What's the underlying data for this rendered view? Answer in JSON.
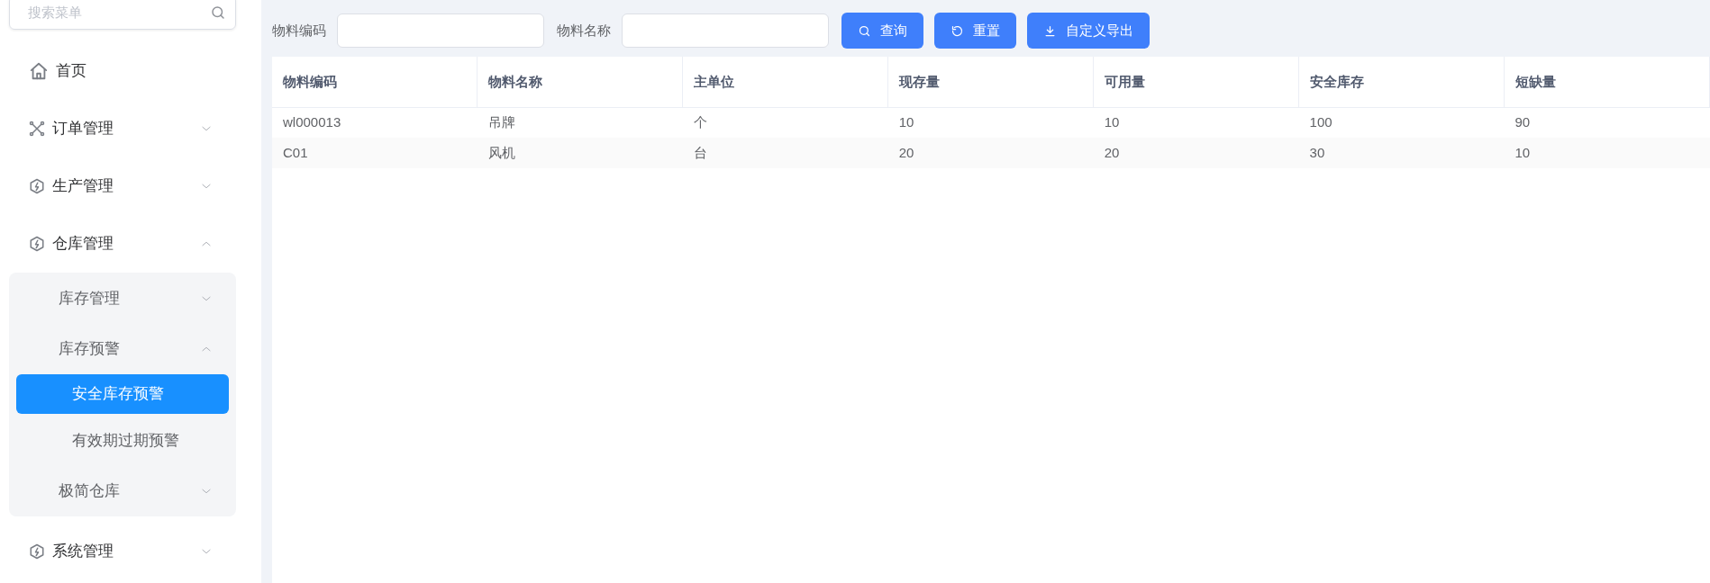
{
  "sidebar": {
    "search": {
      "placeholder": "搜索菜单"
    },
    "items": [
      {
        "label": "首页"
      },
      {
        "label": "订单管理",
        "expanded": false
      },
      {
        "label": "生产管理",
        "expanded": false
      },
      {
        "label": "仓库管理",
        "expanded": true,
        "children": [
          {
            "label": "库存管理",
            "expanded": false
          },
          {
            "label": "库存预警",
            "expanded": true,
            "children": [
              {
                "label": "安全库存预警",
                "selected": true
              },
              {
                "label": "有效期过期预警",
                "selected": false
              }
            ]
          },
          {
            "label": "极简仓库",
            "expanded": false
          }
        ]
      },
      {
        "label": "系统管理",
        "expanded": false
      }
    ]
  },
  "filters": [
    {
      "label": "物料编码"
    },
    {
      "label": "物料名称"
    }
  ],
  "buttons": [
    {
      "label": "查询",
      "kind": "search"
    },
    {
      "label": "重置",
      "kind": "reset"
    },
    {
      "label": "自定义导出",
      "kind": "export"
    }
  ],
  "table": {
    "columns": [
      "物料编码",
      "物料名称",
      "主单位",
      "现存量",
      "可用量",
      "安全库存",
      "短缺量"
    ],
    "rows": [
      [
        "wl000013",
        "吊牌",
        "个",
        "10",
        "10",
        "100",
        "90"
      ],
      [
        "C01",
        "风机",
        "台",
        "20",
        "20",
        "30",
        "10"
      ]
    ]
  }
}
